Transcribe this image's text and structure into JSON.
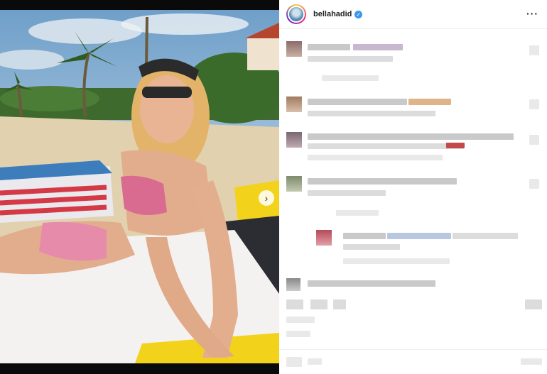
{
  "post": {
    "username": "bellahadid",
    "verified_icon": "verified-badge-icon",
    "more_icon": "more-options-icon",
    "avatar_icon": "story-ring-avatar",
    "next_icon": "chevron-right-icon",
    "verified_glyph": "✓",
    "more_glyph": "···",
    "next_glyph": "›"
  },
  "comments": [
    {
      "name": "comment-1"
    },
    {
      "name": "comment-2"
    },
    {
      "name": "comment-3"
    },
    {
      "name": "comment-4"
    },
    {
      "name": "reply-1"
    },
    {
      "name": "comment-5"
    }
  ],
  "colors": {
    "accent_blue": "#3897f0",
    "panel_bg": "#ffffff",
    "frame": "#000000"
  }
}
